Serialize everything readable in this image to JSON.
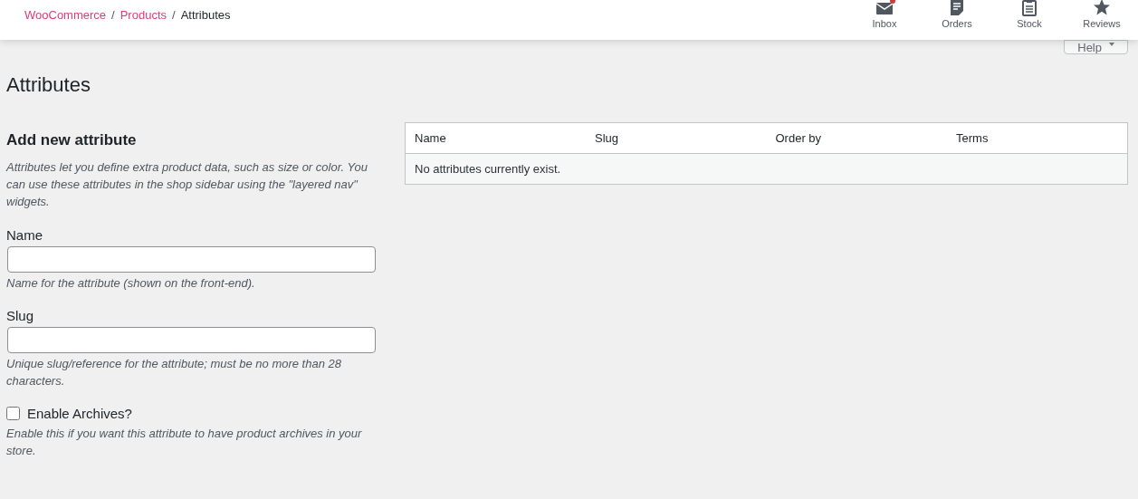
{
  "breadcrumb": [
    {
      "label": "WooCommerce",
      "kind": "link"
    },
    {
      "label": "/",
      "kind": "separator"
    },
    {
      "label": "Products",
      "kind": "link"
    },
    {
      "label": "/",
      "kind": "separator"
    },
    {
      "label": "Attributes",
      "kind": "current"
    }
  ],
  "header_actions": [
    {
      "label": "Inbox",
      "kind": "inbox",
      "unread": true
    },
    {
      "label": "Orders",
      "kind": "orders",
      "unread": false
    },
    {
      "label": "Stock",
      "kind": "stock",
      "unread": false
    },
    {
      "label": "Reviews",
      "kind": "reviews",
      "unread": false
    }
  ],
  "help_button": {
    "label": "Help"
  },
  "page_title": "Attributes",
  "form": {
    "heading": "Add new attribute",
    "intro": "Attributes let you define extra product data, such as size or color. You can use these attributes in the shop sidebar using the \"layered nav\" widgets.",
    "fields": [
      {
        "kind": "text",
        "label": "Name",
        "description": "Name for the attribute (shown on the front-end)."
      },
      {
        "kind": "text",
        "label": "Slug",
        "description": "Unique slug/reference for the attribute; must be no more than 28 characters."
      },
      {
        "kind": "checkbox",
        "label": "Enable Archives?",
        "checked": false,
        "description": "Enable this if you want this attribute to have product archives in your store."
      }
    ]
  },
  "table": {
    "columns": [
      "Name",
      "Slug",
      "Order by",
      "Terms"
    ],
    "empty_message": "No attributes currently exist."
  }
}
